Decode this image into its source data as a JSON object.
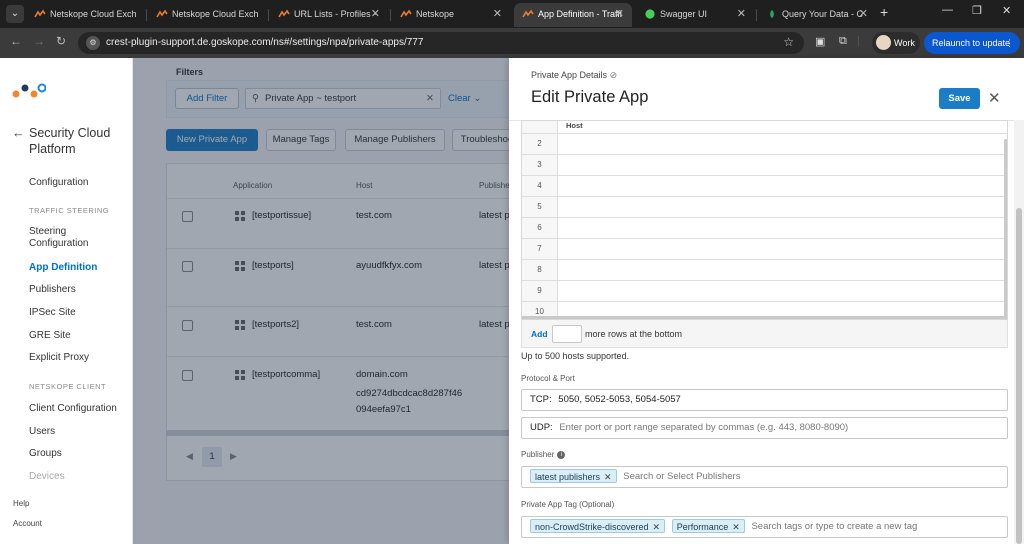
{
  "browser": {
    "tabs": [
      {
        "title": "Netskope Cloud Exch",
        "active": false
      },
      {
        "title": "Netskope Cloud Exch",
        "active": false
      },
      {
        "title": "URL Lists - Profiles - ",
        "active": false
      },
      {
        "title": "Netskope",
        "active": false
      },
      {
        "title": "App Definition - Traffi",
        "active": true
      },
      {
        "title": "Swagger UI",
        "active": false
      },
      {
        "title": "Query Your Data - C",
        "active": false
      }
    ],
    "url": "crest-plugin-support.de.goskope.com/ns#/settings/npa/private-apps/777",
    "profile_label": "Work",
    "relaunch_label": "Relaunch to update"
  },
  "sidebar": {
    "platform_title": "Security Cloud Platform",
    "items": {
      "configuration": "Configuration",
      "section_traffic": "TRAFFIC STEERING",
      "steering": "Steering Configuration",
      "app_definition": "App Definition",
      "publishers": "Publishers",
      "ipsec": "IPSec Site",
      "gre": "GRE Site",
      "explicit_proxy": "Explicit Proxy",
      "section_client": "NETSKOPE CLIENT",
      "client_configuration": "Client Configuration",
      "users": "Users",
      "groups": "Groups",
      "devices": "Devices"
    },
    "help": "Help",
    "account": "Account"
  },
  "main": {
    "filters_label": "Filters",
    "add_filter": "Add Filter",
    "filter_chip": "Private App ~ testport",
    "clear": "Clear",
    "buttons": {
      "new_private_app": "New Private App",
      "manage_tags": "Manage Tags",
      "manage_publishers": "Manage Publishers",
      "troubleshoot": "Troubleshoo"
    },
    "table": {
      "headers": {
        "application": "Application",
        "host": "Host",
        "publisher": "Publishe"
      },
      "rows": [
        {
          "app": "[testportissue]",
          "host": "test.com",
          "host2": "",
          "publisher": "latest p"
        },
        {
          "app": "[testports]",
          "host": "ayuudfkfyx.com",
          "host2": "",
          "publisher": "latest p"
        },
        {
          "app": "[testports2]",
          "host": "test.com",
          "host2": "",
          "publisher": "latest p"
        },
        {
          "app": "[testportcomma]",
          "host": "domain.com",
          "host2": "cd9274dbcdcac8d287f46 094eefa97c1",
          "publisher": ""
        }
      ]
    },
    "page": "1"
  },
  "drawer": {
    "subtitle": "Private App Details",
    "title": "Edit Private App",
    "save": "Save",
    "hosts_grid": {
      "header": "Host",
      "row_numbers": [
        "2",
        "3",
        "4",
        "5",
        "6",
        "7",
        "8",
        "9",
        "10"
      ]
    },
    "add_rows": {
      "add": "Add",
      "suffix": "more rows at the bottom"
    },
    "hosts_note": "Up to 500 hosts supported.",
    "protocol_label": "Protocol & Port",
    "tcp": {
      "prefix": "TCP:",
      "value": "5050, 5052-5053, 5054-5057"
    },
    "udp": {
      "prefix": "UDP:",
      "placeholder": "Enter port or port range separated by commas (e.g. 443, 8080-8090)"
    },
    "publisher_label": "Publisher",
    "publisher_chip": "latest publishers",
    "publisher_placeholder": "Search or Select Publishers",
    "tag_label": "Private App Tag (Optional)",
    "tags": [
      "non-CrowdStrike-discovered",
      "Performance"
    ],
    "tag_placeholder": "Search tags or type to create a new tag"
  },
  "colors": {
    "accent": "#1a7dc6",
    "active_nav": "#0070c9",
    "chrome_dark": "#1f1f1f",
    "relaunch": "#0b57d0"
  }
}
